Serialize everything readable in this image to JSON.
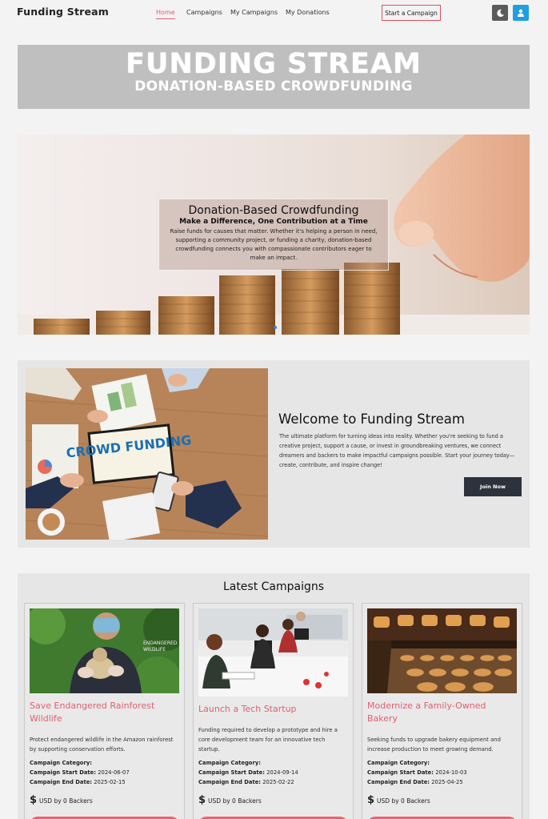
{
  "nav": {
    "brand": "Funding Stream",
    "links": [
      "Home",
      "Campaigns",
      "My Campaigns",
      "My Donations"
    ],
    "start_label": "Start a Campaign"
  },
  "banner": {
    "title": "FUNDING STREAM",
    "subtitle": "DONATION-BASED CROWDFUNDING"
  },
  "hero": {
    "title": "Donation-Based Crowdfunding",
    "subtitle": "Make a Difference, One Contribution at a Time",
    "text": "Raise funds for causes that matter. Whether it's helping a person in need, supporting a community project, or funding a charity, donation-based crowdfunding connects you with compassionate contributors eager to make an impact."
  },
  "welcome": {
    "image_text": "CROWD FUNDING",
    "title": "Welcome to Funding Stream",
    "text": "The ultimate platform for turning ideas into reality. Whether you're seeking to fund a creative project, support a cause, or invest in groundbreaking ventures, we connect dreamers and backers to make impactful campaigns possible. Start your journey today—create, contribute, and inspire change!",
    "join_label": "Join Now"
  },
  "latest": {
    "title": "Latest Campaigns",
    "labels": {
      "category": "Campaign Category:",
      "start": "Campaign Start Date:",
      "end": "Campaign End Date:",
      "fund_suffix": "USD by 0 Backers",
      "dollar": "$"
    },
    "campaigns": [
      {
        "title": "Save Endangered Rainforest Wildlife",
        "desc": "Protect endangered wildlife in the Amazon rainforest by supporting conservation efforts.",
        "start": "2024-06-07",
        "end": "2025-02-15"
      },
      {
        "title": "Launch a Tech Startup",
        "desc": "Funding required to develop a prototype and hire a core development team for an innovative tech startup.",
        "start": "2024-09-14",
        "end": "2025-02-22"
      },
      {
        "title": "Modernize a Family-Owned Bakery",
        "desc": "Seeking funds to upgrade bakery equipment and increase production to meet growing demand.",
        "start": "2024-10-03",
        "end": "2025-04-25"
      }
    ]
  },
  "colors": {
    "accent": "#e06070",
    "user_button": "#1ea0e0",
    "join_button": "#2d333c"
  }
}
